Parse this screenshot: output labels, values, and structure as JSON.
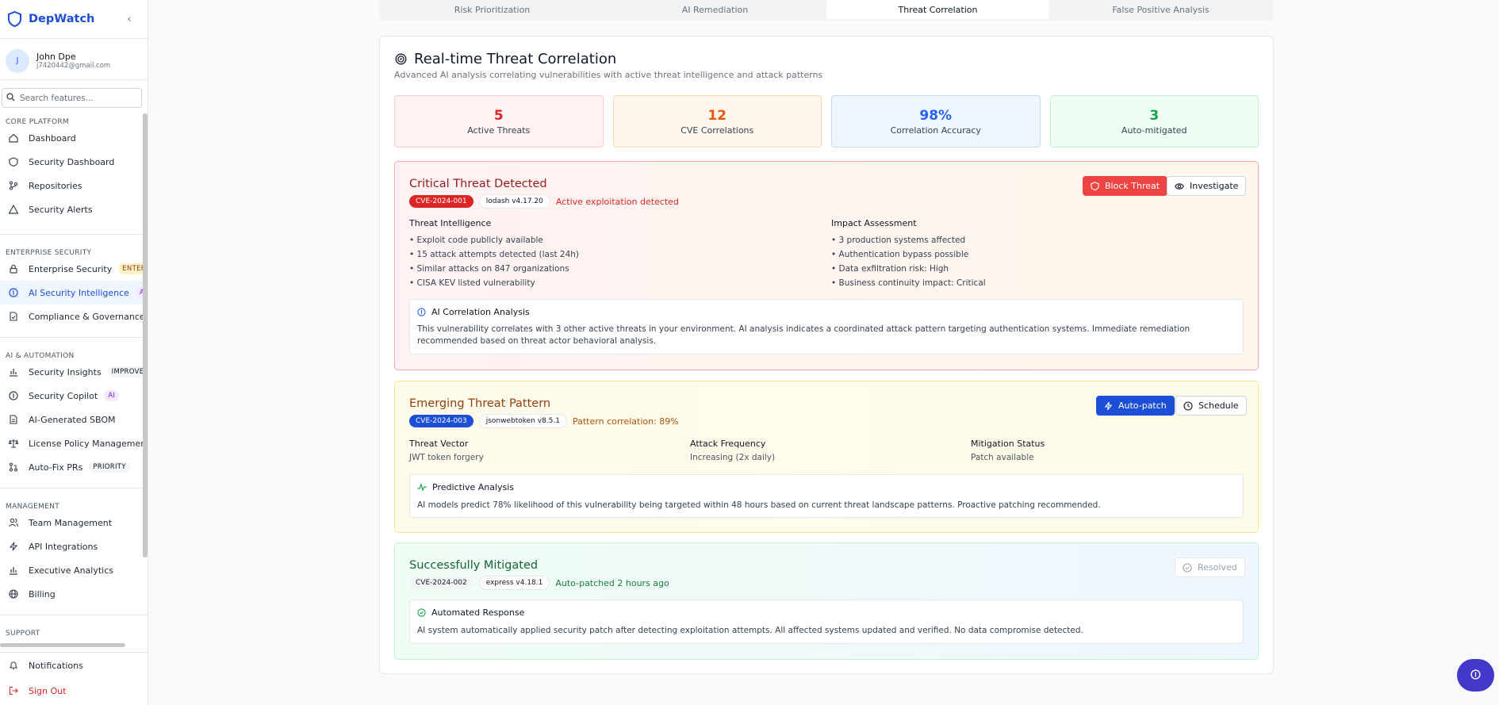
{
  "brand": {
    "name": "DepWatch"
  },
  "user": {
    "initial": "J",
    "name": "John Dpe",
    "email": "j7420442@gmail.com"
  },
  "search": {
    "placeholder": "Search features..."
  },
  "nav": {
    "core": {
      "label": "CORE PLATFORM",
      "items": [
        "Dashboard",
        "Security Dashboard",
        "Repositories",
        "Security Alerts"
      ]
    },
    "enterprise": {
      "label": "ENTERPRISE SECURITY",
      "items": [
        "Enterprise Security",
        "AI Security Intelligence",
        "Compliance & Governance"
      ],
      "badges": [
        "ENTERPRISE",
        "AI"
      ]
    },
    "ai": {
      "label": "AI & AUTOMATION",
      "items": [
        "Security Insights",
        "Security Copilot",
        "AI-Generated SBOM",
        "License Policy Management",
        "Auto-Fix PRs"
      ],
      "badges": [
        "IMPROVED",
        "AI",
        "PRIORITY"
      ]
    },
    "management": {
      "label": "MANAGEMENT",
      "items": [
        "Team Management",
        "API Integrations",
        "Executive Analytics",
        "Billing"
      ]
    },
    "support": {
      "label": "SUPPORT"
    },
    "bottom": [
      "Notifications",
      "Sign Out"
    ]
  },
  "tabs": [
    "Risk Prioritization",
    "AI Remediation",
    "Threat Correlation",
    "False Positive Analysis"
  ],
  "header": {
    "title": "Real-time Threat Correlation",
    "subtitle": "Advanced AI analysis correlating vulnerabilities with active threat intelligence and attack patterns"
  },
  "stats": [
    {
      "value": "5",
      "label": "Active Threats"
    },
    {
      "value": "12",
      "label": "CVE Correlations"
    },
    {
      "value": "98%",
      "label": "Correlation Accuracy"
    },
    {
      "value": "3",
      "label": "Auto-mitigated"
    }
  ],
  "critical": {
    "title": "Critical Threat Detected",
    "cve": "CVE-2024-001",
    "package": "lodash v4.17.20",
    "note": "Active exploitation detected",
    "buttons": {
      "block": "Block Threat",
      "investigate": "Investigate"
    },
    "intel": {
      "heading": "Threat Intelligence",
      "items": [
        "• Exploit code publicly available",
        "• 15 attack attempts detected (last 24h)",
        "• Similar attacks on 847 organizations",
        "• CISA KEV listed vulnerability"
      ]
    },
    "impact": {
      "heading": "Impact Assessment",
      "items": [
        "• 3 production systems affected",
        "• Authentication bypass possible",
        "• Data exfiltration risk: High",
        "• Business continuity impact: Critical"
      ]
    },
    "analysis": {
      "title": "AI Correlation Analysis",
      "text": "This vulnerability correlates with 3 other active threats in your environment. AI analysis indicates a coordinated attack pattern targeting authentication systems. Immediate remediation recommended based on threat actor behavioral analysis."
    }
  },
  "emerging": {
    "title": "Emerging Threat Pattern",
    "cve": "CVE-2024-003",
    "package": "jsonwebtoken v8.5.1",
    "note": "Pattern correlation: 89%",
    "buttons": {
      "autopatch": "Auto-patch",
      "schedule": "Schedule"
    },
    "cols": [
      {
        "heading": "Threat Vector",
        "value": "JWT token forgery"
      },
      {
        "heading": "Attack Frequency",
        "value": "Increasing (2x daily)"
      },
      {
        "heading": "Mitigation Status",
        "value": "Patch available"
      }
    ],
    "analysis": {
      "title": "Predictive Analysis",
      "text": "AI models predict 78% likelihood of this vulnerability being targeted within 48 hours based on current threat landscape patterns. Proactive patching recommended."
    }
  },
  "mitigated": {
    "title": "Successfully Mitigated",
    "cve": "CVE-2024-002",
    "package": "express v4.18.1",
    "note": "Auto-patched 2 hours ago",
    "status": "Resolved",
    "analysis": {
      "title": "Automated Response",
      "text": "AI system automatically applied security patch after detecting exploitation attempts. All affected systems updated and verified. No data compromise detected."
    }
  },
  "colors": {
    "accent": "#1d4ed8",
    "critical": "#dc2626",
    "warning": "#b45309",
    "success": "#15803d"
  }
}
